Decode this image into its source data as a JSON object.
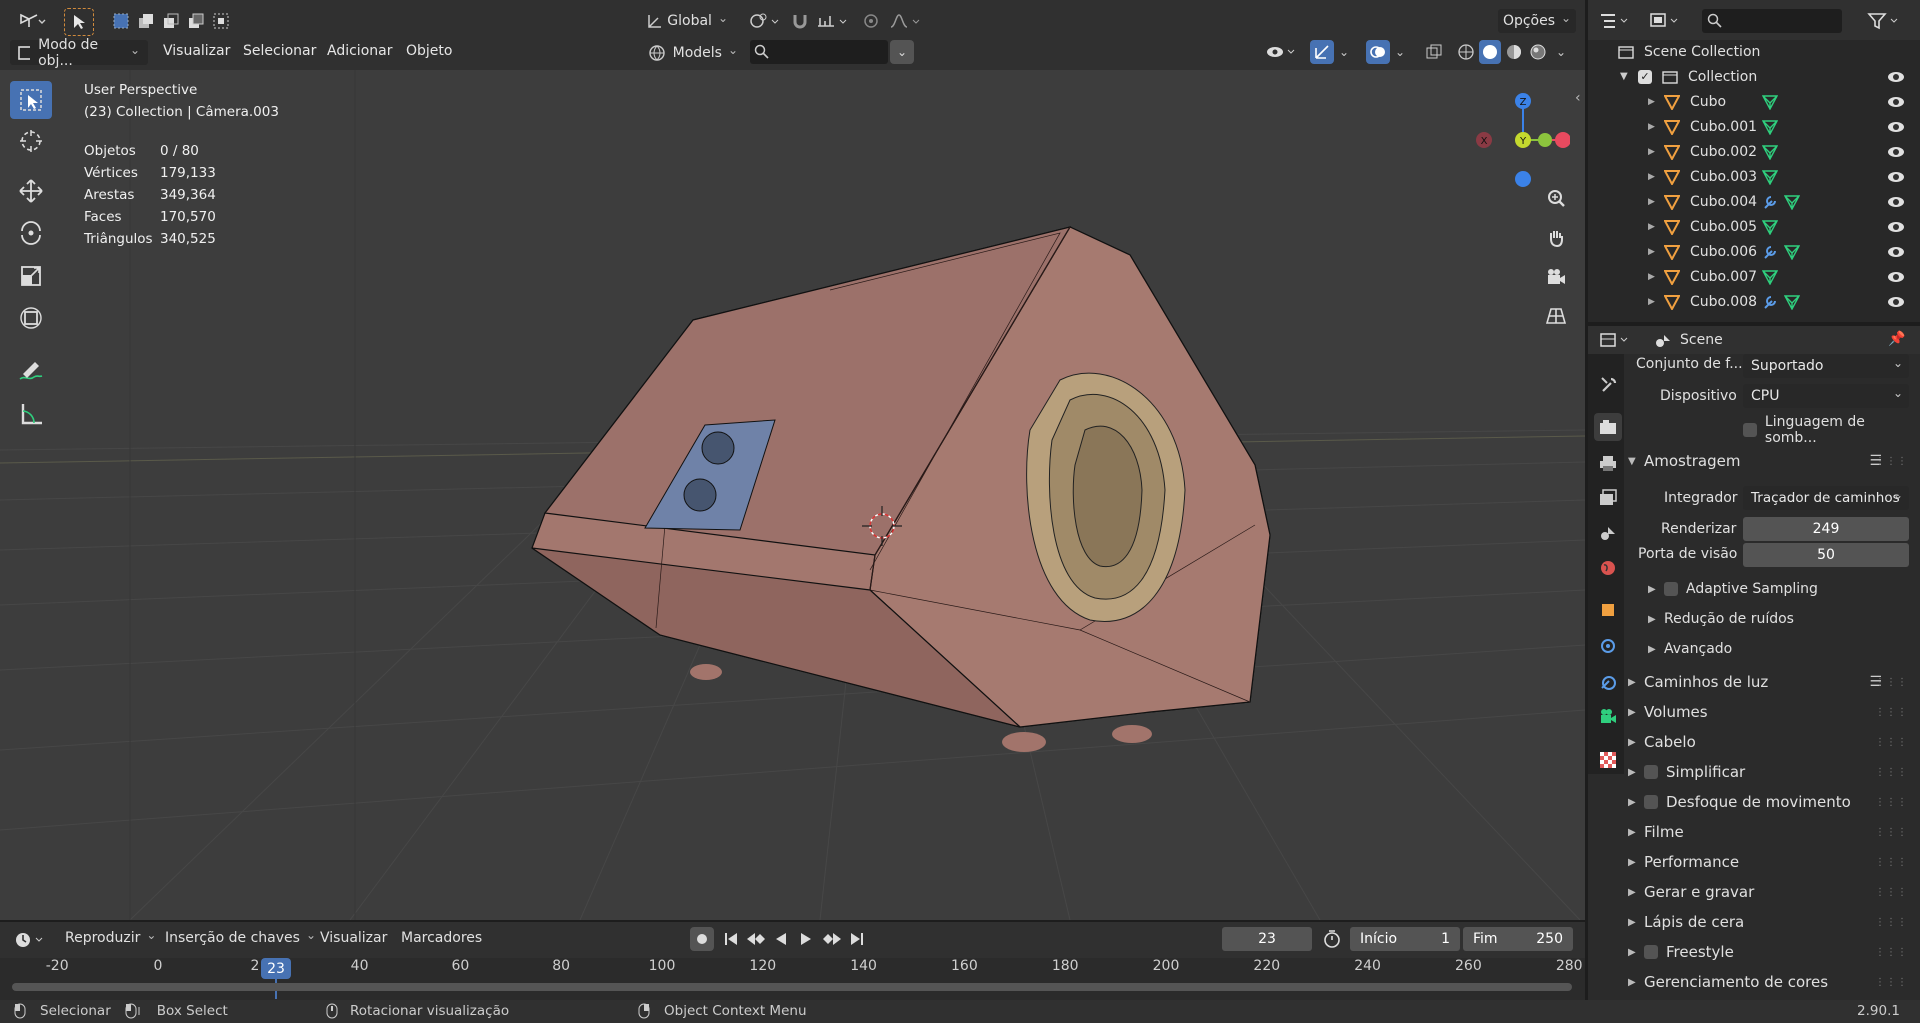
{
  "colors": {
    "accent": "#4772b3",
    "model": "#a2746b",
    "x_axis": "#e84a5f",
    "y_axis": "#8cc43d",
    "z_axis": "#3b82e8",
    "mesh_icon": "#2fcf7e",
    "obj_icon": "#f0a040"
  },
  "header": {
    "orientation": "Global",
    "options_label": "Opções",
    "collection_filter": "Models"
  },
  "viewport_menu": {
    "mode": "Modo de obj...",
    "items": [
      "Visualizar",
      "Selecionar",
      "Adicionar",
      "Objeto"
    ]
  },
  "overlay": {
    "view_name": "User Perspective",
    "context": "(23) Collection | Câmera.003",
    "stats": [
      {
        "label": "Objetos",
        "value": "0 / 80"
      },
      {
        "label": "Vértices",
        "value": "179,133"
      },
      {
        "label": "Arestas",
        "value": "349,364"
      },
      {
        "label": "Faces",
        "value": "170,570"
      },
      {
        "label": "Triângulos",
        "value": "340,525"
      }
    ]
  },
  "gizmo": {
    "x": "X",
    "y": "Y",
    "z": "Z"
  },
  "outliner": {
    "root": "Scene Collection",
    "collection": "Collection",
    "items": [
      {
        "name": "Cubo",
        "modifier": false
      },
      {
        "name": "Cubo.001",
        "modifier": false
      },
      {
        "name": "Cubo.002",
        "modifier": false
      },
      {
        "name": "Cubo.003",
        "modifier": false
      },
      {
        "name": "Cubo.004",
        "modifier": true
      },
      {
        "name": "Cubo.005",
        "modifier": false
      },
      {
        "name": "Cubo.006",
        "modifier": true
      },
      {
        "name": "Cubo.007",
        "modifier": false
      },
      {
        "name": "Cubo.008",
        "modifier": true
      }
    ]
  },
  "properties": {
    "scene_label": "Scene",
    "feature_set_label": "Conjunto de f...",
    "feature_set_value": "Suportado",
    "device_label": "Dispositivo",
    "device_value": "CPU",
    "osl_label": "Linguagem de somb...",
    "sampling_title": "Amostragem",
    "integrator_label": "Integrador",
    "integrator_value": "Traçador de caminhos",
    "render_label": "Renderizar",
    "render_value": "249",
    "viewport_label": "Porta de visão",
    "viewport_value": "50",
    "sub_panels": [
      "Adaptive Sampling",
      "Redução de ruídos",
      "Avançado"
    ],
    "panels": [
      {
        "label": "Caminhos de luz",
        "check": false
      },
      {
        "label": "Volumes",
        "check": false
      },
      {
        "label": "Cabelo",
        "check": false
      },
      {
        "label": "Simplificar",
        "check": true
      },
      {
        "label": "Desfoque de movimento",
        "check": true
      },
      {
        "label": "Filme",
        "check": false
      },
      {
        "label": "Performance",
        "check": false
      },
      {
        "label": "Gerar e gravar",
        "check": false
      },
      {
        "label": "Lápis de cera",
        "check": false
      },
      {
        "label": "Freestyle",
        "check": true
      },
      {
        "label": "Gerenciamento de cores",
        "check": false
      }
    ]
  },
  "timeline": {
    "menus": [
      "Reproduzir",
      "Inserção de chaves",
      "Visualizar",
      "Marcadores"
    ],
    "current_frame": "23",
    "start_label": "Início",
    "start_value": "1",
    "end_label": "Fim",
    "end_value": "250",
    "ruler": [
      "-20",
      "0",
      "2",
      "40",
      "60",
      "80",
      "100",
      "120",
      "140",
      "160",
      "180",
      "200",
      "220",
      "240",
      "260",
      "280"
    ],
    "playhead": "23"
  },
  "statusbar": {
    "items": [
      "Selecionar",
      "Box Select",
      "Rotacionar visualização",
      "Object Context Menu"
    ],
    "version": "2.90.1"
  }
}
